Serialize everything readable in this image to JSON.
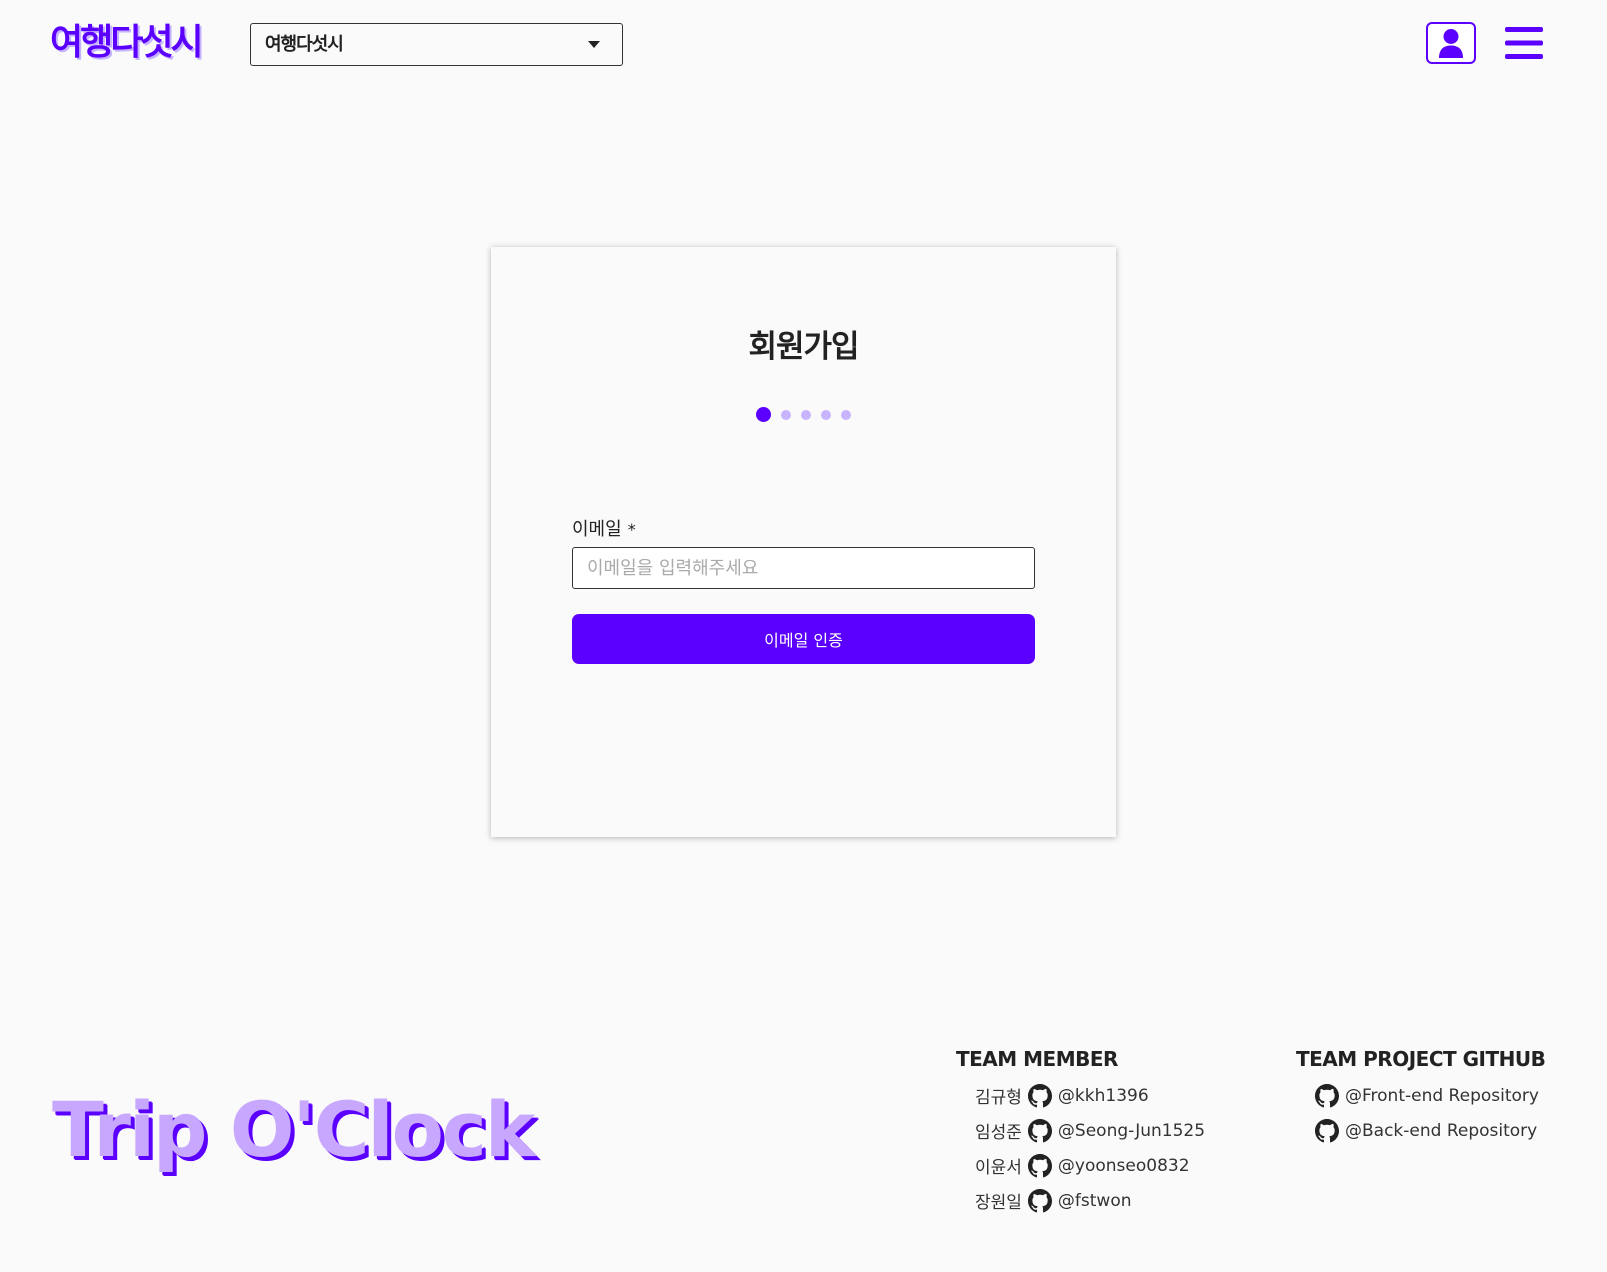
{
  "header": {
    "logo_text": "여행다섯시",
    "site_select": {
      "selected": "여행다섯시"
    },
    "icons": {
      "user": "user-icon",
      "menu": "hamburger-menu-icon"
    }
  },
  "signup": {
    "title": "회원가입",
    "steps": {
      "total": 5,
      "current": 1
    },
    "email_label": "이메일",
    "required_mark": "*",
    "email_placeholder": "이메일을 입력해주세요",
    "email_value": "",
    "verify_button": "이메일 인증"
  },
  "footer": {
    "brand": "Trip O'Clock",
    "team_heading": "TEAM MEMBER",
    "members": [
      {
        "name": "김규형",
        "handle": "@kkh1396"
      },
      {
        "name": "임성준",
        "handle": "@Seong-Jun1525"
      },
      {
        "name": "이윤서",
        "handle": "@yoonseo0832"
      },
      {
        "name": "장원일",
        "handle": "@fstwon"
      }
    ],
    "github_heading": "TEAM PROJECT GITHUB",
    "repos": [
      {
        "label": "@Front-end Repository"
      },
      {
        "label": "@Back-end Repository"
      }
    ],
    "icon": "github-icon"
  },
  "colors": {
    "accent": "#5b00ff",
    "accent_light": "#c8b3ff",
    "background": "#fafafa"
  }
}
